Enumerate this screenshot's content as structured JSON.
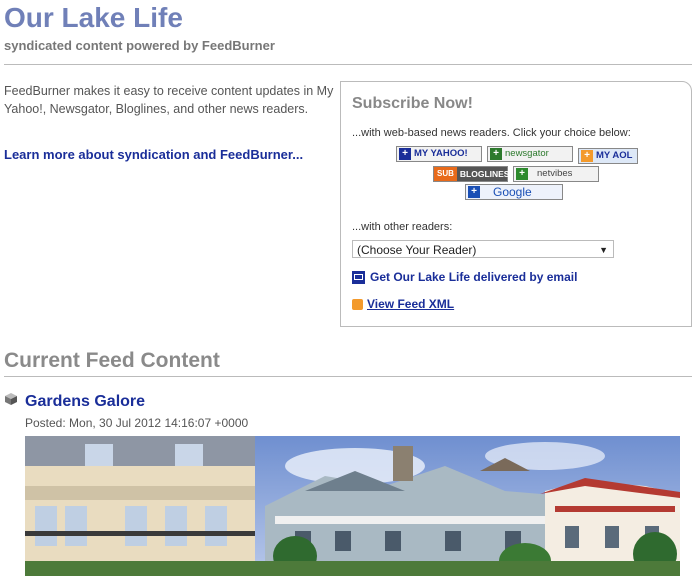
{
  "header": {
    "title": "Our Lake Life",
    "subtitle": "syndicated content powered by FeedBurner"
  },
  "intro": {
    "text": "FeedBurner makes it easy to receive content updates in My Yahoo!, Newsgator, Bloglines, and other news readers.",
    "learn_more": "Learn more about syndication and FeedBurner..."
  },
  "subscribe": {
    "heading": "Subscribe Now!",
    "web_readers_prompt": "...with web-based news readers. Click your choice below:",
    "readers": [
      {
        "name": "MY YAHOO!",
        "color": "#1a2e99"
      },
      {
        "name": "newsgator",
        "color": "#2d7a2d"
      },
      {
        "name": "MY AOL",
        "color": "#f39a2c"
      },
      {
        "name": "BLOGLINES",
        "color": "#e86a1a"
      },
      {
        "name": "netvibes",
        "color": "#2d8a2d"
      },
      {
        "name": "Google",
        "color": "#1a4fb5"
      }
    ],
    "other_readers_prompt": "...with other readers:",
    "reader_select": "(Choose Your Reader)",
    "email_link": "Get Our Lake Life delivered by email",
    "xml_link": "View Feed XML"
  },
  "feed": {
    "heading": "Current Feed Content",
    "items": [
      {
        "title": "Gardens Galore",
        "posted_label": "Posted:",
        "posted_date": "Mon, 30 Jul 2012 14:16:07 +0000"
      }
    ]
  }
}
